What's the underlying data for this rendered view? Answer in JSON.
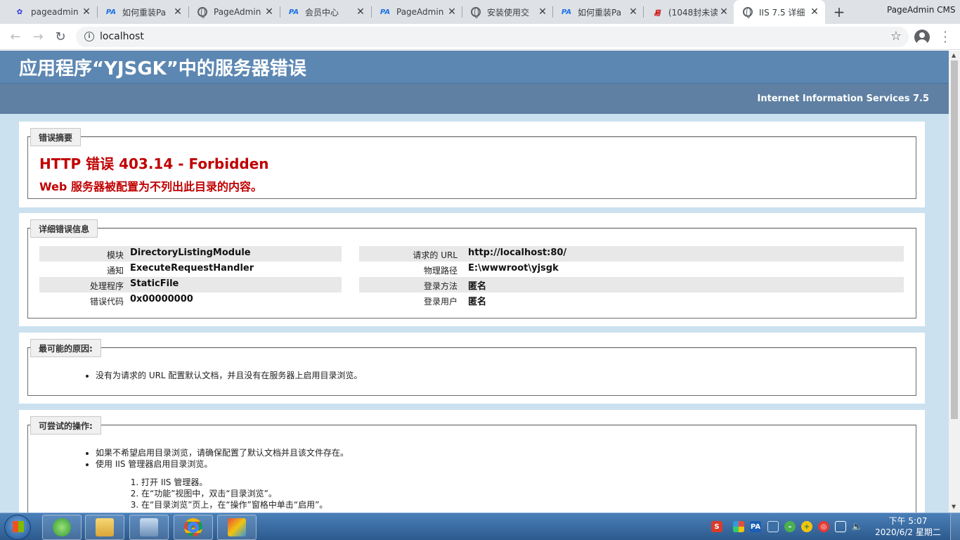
{
  "browser": {
    "tabs": [
      {
        "label": "pageadmin",
        "icon": "baidu-paw-icon",
        "active": false
      },
      {
        "label": "如何重装Pa",
        "icon": "pageadmin-icon",
        "active": false
      },
      {
        "label": "PageAdmin",
        "icon": "globe-icon",
        "active": false
      },
      {
        "label": "会员中心",
        "icon": "pageadmin-icon",
        "active": false
      },
      {
        "label": "PageAdmin",
        "icon": "pageadmin-icon",
        "active": false
      },
      {
        "label": "安装使用交",
        "icon": "globe-icon",
        "active": false
      },
      {
        "label": "如何重装Pa",
        "icon": "pageadmin-icon",
        "active": false
      },
      {
        "label": "(1048封未读",
        "icon": "mail-icon",
        "active": false
      },
      {
        "label": "IIS 7.5 详细",
        "icon": "globe-icon",
        "active": true
      }
    ],
    "window_title": "PageAdmin CMS",
    "url": "localhost"
  },
  "page": {
    "title": "应用程序“YJSGK”中的服务器错误",
    "subheader": "Internet Information Services 7.5",
    "summary": {
      "legend": "错误摘要",
      "heading": "HTTP 错误 403.14 - Forbidden",
      "detail": "Web 服务器被配置为不列出此目录的内容。"
    },
    "details": {
      "legend": "详细错误信息",
      "left": [
        {
          "label": "模块",
          "value": "DirectoryListingModule"
        },
        {
          "label": "通知",
          "value": "ExecuteRequestHandler"
        },
        {
          "label": "处理程序",
          "value": "StaticFile"
        },
        {
          "label": "错误代码",
          "value": "0x00000000"
        }
      ],
      "right": [
        {
          "label": "请求的 URL",
          "value": "http://localhost:80/"
        },
        {
          "label": "物理路径",
          "value": "E:\\wwwroot\\yjsgk"
        },
        {
          "label": "登录方法",
          "value": "匿名"
        },
        {
          "label": "登录用户",
          "value": "匿名"
        }
      ]
    },
    "causes": {
      "legend": "最可能的原因:",
      "items": [
        "没有为请求的 URL 配置默认文档，并且没有在服务器上启用目录浏览。"
      ]
    },
    "actions": {
      "legend": "可尝试的操作:",
      "items": [
        "如果不希望启用目录浏览，请确保配置了默认文档并且该文件存在。",
        "使用 IIS 管理器启用目录浏览。"
      ],
      "steps": [
        "打开 IIS 管理器。",
        "在“功能”视图中，双击“目录浏览”。",
        "在“目录浏览”页上，在“操作”窗格中单击“启用”。"
      ]
    }
  },
  "taskbar": {
    "clock_time": "下午 5:07",
    "clock_date": "2020/6/2 星期二",
    "pinned": [
      "ie-icon",
      "explorer-icon",
      "control-panel-icon",
      "chrome-icon",
      "tools-icon"
    ],
    "tray_pa_label": "PA",
    "colors": {
      "accent": "#5c87b2",
      "error": "#c00000"
    }
  }
}
